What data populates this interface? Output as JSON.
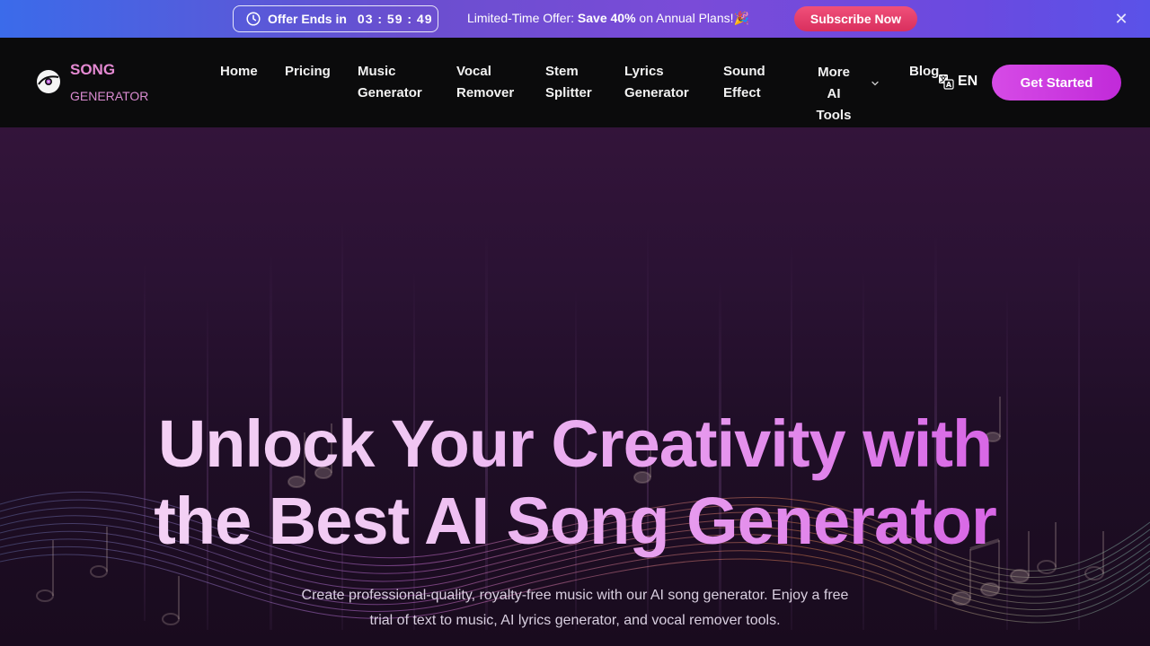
{
  "promo": {
    "timer_label": "Offer Ends in",
    "timer_value": "03 : 59 : 49",
    "offer_prefix": "Limited-Time Offer: ",
    "offer_highlight": "Save 40%",
    "offer_suffix": " on Annual Plans!🎉",
    "subscribe_label": "Subscribe Now",
    "close_icon": "close-icon"
  },
  "nav": {
    "logo_top": "SONG",
    "logo_bottom": "GENERATOR",
    "items": [
      {
        "line1": "Home",
        "line2": ""
      },
      {
        "line1": "Pricing",
        "line2": ""
      },
      {
        "line1": "Music",
        "line2": "Generator"
      },
      {
        "line1": "Vocal",
        "line2": "Remover"
      },
      {
        "line1": "Stem",
        "line2": "Splitter"
      },
      {
        "line1": "Lyrics",
        "line2": "Generator"
      },
      {
        "line1": "Sound",
        "line2": "Effect"
      },
      {
        "line1": "More AI",
        "line2": "Tools"
      },
      {
        "line1": "Blog",
        "line2": ""
      }
    ],
    "language": "EN",
    "cta_label": "Get Started"
  },
  "hero": {
    "title_line1": "Unlock Your Creativity with",
    "title_line2": "the Best AI Song Generator",
    "subtitle_line1": "Create professional-quality, royalty-free music with our AI song generator. Enjoy a free",
    "subtitle_line2": "trial of text to music, AI lyrics generator, and vocal remover tools."
  },
  "colors": {
    "accent_pink": "#d64be6",
    "subscribe_red": "#e03f6b",
    "logo_pink": "#e58ad3"
  }
}
